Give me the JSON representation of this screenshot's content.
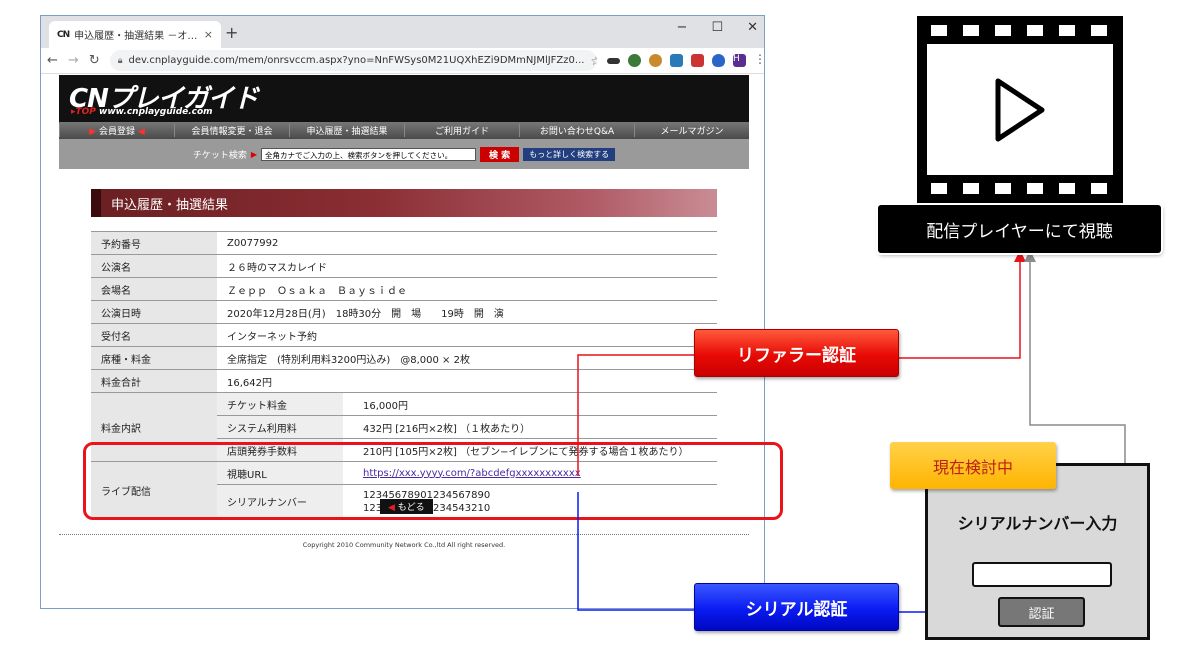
{
  "browser": {
    "tab_icon": "CN",
    "tab_title": "申込履歴・抽選結果 －オンラインチ",
    "tab_close": "×",
    "new_tab": "+",
    "window_controls": [
      "−",
      "☐",
      "✕"
    ],
    "url": "dev.cnplayguide.com/mem/onrsvccm.aspx?yno=NnFWSys0M21UQXhEZi9DMmNJMlJFZz0...",
    "avatar": "H"
  },
  "site": {
    "logo": "CNプレイガイド",
    "logo_top": "▸TOP",
    "logo_url": "www.cnplayguide.com",
    "nav": [
      "会員登録",
      "会員情報変更・退会",
      "申込履歴・抽選結果",
      "ご利用ガイド",
      "お問い合わせQ&A",
      "メールマガジン"
    ],
    "search_label": "チケット検索",
    "search_placeholder": "全角カナでご入力の上、検索ボタンを押してください。",
    "search_button": "検 索",
    "detail_button": "もっと詳しく検索する",
    "section_title": "申込履歴・抽選結果",
    "rows": {
      "reservation_no": {
        "label": "予約番号",
        "value": "Z0077992"
      },
      "performance": {
        "label": "公演名",
        "value": "２６時のマスカレイド"
      },
      "venue": {
        "label": "会場名",
        "value": "Ｚｅｐｐ　Ｏｓａｋａ　Ｂａｙｓｉｄｅ"
      },
      "datetime": {
        "label": "公演日時",
        "value": "2020年12月28日(月)　18時30分　開　場　　19時　開　演"
      },
      "reception": {
        "label": "受付名",
        "value": "インターネット予約"
      },
      "seat": {
        "label": "席種・料金",
        "value": "全席指定　(特別利用料3200円込み)　@8,000 × 2枚"
      },
      "total": {
        "label": "料金合計",
        "value": "16,642円"
      },
      "breakdown_label": "料金内訳",
      "ticket_fee": {
        "label": "チケット料金",
        "value": "16,000円"
      },
      "system_fee": {
        "label": "システム利用料",
        "value": "432円 [216円×2枚] （１枚あたり）"
      },
      "store_fee": {
        "label": "店頭発券手数料",
        "value": "210円 [105円×2枚] （セブン−イレブンにて発券する場合１枚あたり）"
      },
      "live_label": "ライブ配信",
      "view_url": {
        "label": "視聴URL",
        "value": "https://xxx.yyyy.com/?abcdefgxxxxxxxxxxx"
      },
      "serial": {
        "label": "シリアルナンバー",
        "value1": "12345678901234567890",
        "value2": "12345678901234543210"
      }
    },
    "back_button": "もどる",
    "copyright": "Copyright 2010 Community Network Co.,ltd All right reserved."
  },
  "diagram": {
    "referrer_auth": "リファラー認証",
    "serial_auth": "シリアル認証",
    "under_review": "現在検討中",
    "player_label": "配信プレイヤーにて視聴",
    "panel_title": "シリアルナンバー入力",
    "panel_button": "認証",
    "icon": "play-icon",
    "colors": {
      "red": "#e8141a",
      "blue": "#0a1bf2",
      "gray_line": "#8a8a8a",
      "yellow": "#ffc000"
    }
  }
}
